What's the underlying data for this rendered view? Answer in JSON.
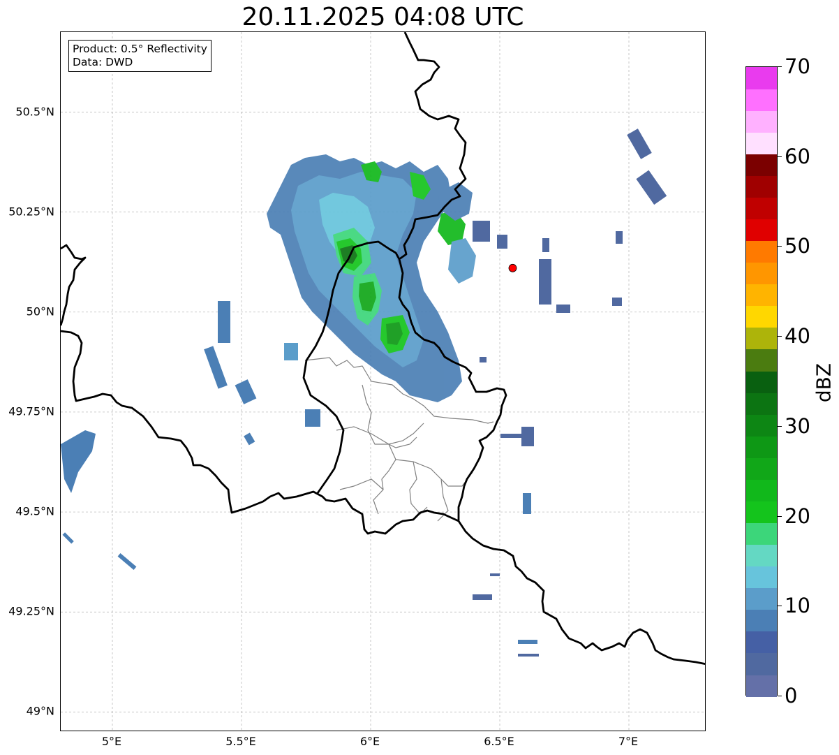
{
  "title": "20.11.2025 04:08 UTC",
  "info": {
    "product": "Product: 0.5° Reflectivity",
    "data_source": "Data: DWD"
  },
  "map": {
    "extent": {
      "lon_min": 4.8,
      "lon_max": 7.3,
      "lat_min": 48.95,
      "lat_max": 50.7
    },
    "lat_ticks": [
      {
        "value": 49.0,
        "label": "49°N"
      },
      {
        "value": 49.25,
        "label": "49.25°N"
      },
      {
        "value": 49.5,
        "label": "49.5°N"
      },
      {
        "value": 49.75,
        "label": "49.75°N"
      },
      {
        "value": 50.0,
        "label": "50°N"
      },
      {
        "value": 50.25,
        "label": "50.25°N"
      },
      {
        "value": 50.5,
        "label": "50.5°N"
      }
    ],
    "lon_ticks": [
      {
        "value": 5.0,
        "label": "5°E"
      },
      {
        "value": 5.5,
        "label": "5.5°E"
      },
      {
        "value": 6.0,
        "label": "6°E"
      },
      {
        "value": 6.5,
        "label": "6.5°E"
      },
      {
        "value": 7.0,
        "label": "7°E"
      }
    ],
    "grid": true,
    "radar_site": {
      "lon": 6.55,
      "lat": 50.11,
      "color": "#ff0000"
    },
    "border_color": "#000000",
    "region_border_color": "#808080"
  },
  "colorbar": {
    "unit": "dBZ",
    "min": 0,
    "max": 70,
    "ticks": [
      {
        "value": 0,
        "label": "0"
      },
      {
        "value": 10,
        "label": "10"
      },
      {
        "value": 20,
        "label": "20"
      },
      {
        "value": 30,
        "label": "30"
      },
      {
        "value": 40,
        "label": "40"
      },
      {
        "value": 50,
        "label": "50"
      },
      {
        "value": 60,
        "label": "60"
      },
      {
        "value": 70,
        "label": "70"
      }
    ],
    "colors": [
      "#6470a8",
      "#5069a0",
      "#4560a5",
      "#4b7fb5",
      "#5b9dca",
      "#67c4dc",
      "#64d8c3",
      "#3cd67a",
      "#14c41c",
      "#11b81b",
      "#11a718",
      "#0e9815",
      "#0d8614",
      "#0c7412",
      "#096010",
      "#4b7c10",
      "#adb40a",
      "#ffd700",
      "#ffb400",
      "#ff9600",
      "#ff7a00",
      "#e00000",
      "#c00000",
      "#a00000",
      "#7b0000",
      "#ffe0ff",
      "#ffb1ff",
      "#ff70ff",
      "#e93bee"
    ]
  }
}
